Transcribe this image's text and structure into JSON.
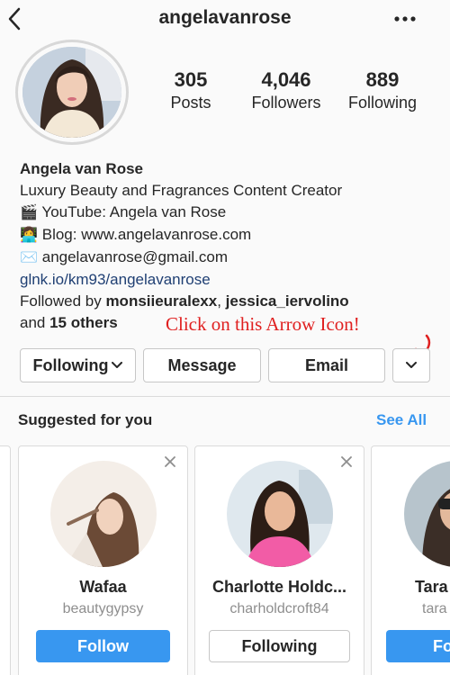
{
  "header": {
    "username": "angelavanrose"
  },
  "profile": {
    "stats": {
      "posts": {
        "value": "305",
        "label": "Posts"
      },
      "followers": {
        "value": "4,046",
        "label": "Followers"
      },
      "following": {
        "value": "889",
        "label": "Following"
      }
    },
    "bio": {
      "name": "Angela van Rose",
      "line1": "Luxury Beauty and Fragrances Content Creator",
      "youtube": "YouTube: Angela van Rose",
      "blog": "Blog: www.angelavanrose.com",
      "email": "angelavanrose@gmail.com",
      "link": "glnk.io/km93/angelavanrose",
      "followed_by_prefix": "Followed by ",
      "followed_by_user1": "monsiieuralexx",
      "followed_by_sep": ", ",
      "followed_by_user2": "jessica_iervolino",
      "and_prefix": "and ",
      "others": "15 others"
    },
    "emojis": {
      "clapper": "🎬",
      "blogger": "👩‍💻",
      "envelope": "✉️"
    }
  },
  "annotation": {
    "text": "Click on this Arrow Icon!",
    "color": "#e02020"
  },
  "actions": {
    "following": "Following",
    "message": "Message",
    "email": "Email"
  },
  "suggested": {
    "title": "Suggested for you",
    "see_all": "See All",
    "cards": [
      {
        "name": "Wafaa",
        "handle": "beautygypsy",
        "button": "Follow"
      },
      {
        "name": "Charlotte Holdc...",
        "handle": "charholdcroft84",
        "button": "Following"
      },
      {
        "name": "Tara",
        "handle": "tara",
        "button": "Fo"
      }
    ]
  },
  "colors": {
    "accent": "#3897f0",
    "link": "#1f3f73",
    "text": "#262626",
    "muted": "#8e8e8e"
  }
}
